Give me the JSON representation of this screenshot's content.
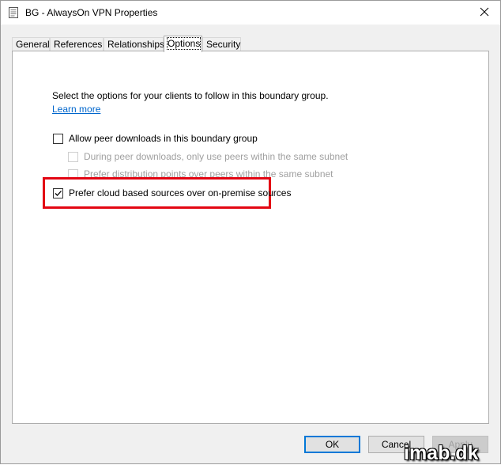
{
  "window": {
    "title": "BG - AlwaysOn VPN Properties"
  },
  "tabs": [
    {
      "label": "General"
    },
    {
      "label": "References"
    },
    {
      "label": "Relationships"
    },
    {
      "label": "Options",
      "active": true
    },
    {
      "label": "Security"
    }
  ],
  "options": {
    "description": "Select the options for your clients to follow in this boundary group.",
    "learn_more": "Learn more",
    "checkboxes": [
      {
        "label": "Allow peer downloads in this boundary group",
        "checked": false,
        "enabled": true
      },
      {
        "label": "During peer downloads, only use peers within the same subnet",
        "checked": false,
        "enabled": false
      },
      {
        "label": "Prefer distribution points over peers within the same subnet",
        "checked": false,
        "enabled": false
      },
      {
        "label": "Prefer cloud based sources over on-premise sources",
        "checked": true,
        "enabled": true
      }
    ]
  },
  "buttons": {
    "ok": "OK",
    "cancel": "Cancel",
    "apply": "Apply"
  },
  "watermark": "imab.dk",
  "colors": {
    "highlight": "#e30613",
    "link": "#0066cc",
    "primary_border": "#0078d7"
  }
}
